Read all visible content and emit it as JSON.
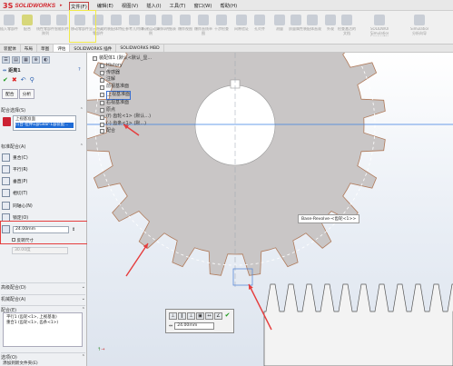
{
  "app": {
    "name": "SOLIDWORKS",
    "brand_color": "#d2232a"
  },
  "menu": [
    "文件(F)",
    "编辑(E)",
    "视图(V)",
    "插入(I)",
    "工具(T)",
    "窗口(W)",
    "帮助(H)"
  ],
  "ribbon": {
    "buttons": [
      {
        "label": "插入零部件",
        "icon": "insert-component-icon"
      },
      {
        "label": "配合",
        "icon": "mate-icon"
      },
      {
        "label": "线性零部件阵列",
        "icon": "linear-pattern-icon"
      },
      {
        "label": "智能扣件",
        "icon": "smart-fastener-icon"
      },
      {
        "label": "移动零部件",
        "icon": "move-component-icon"
      },
      {
        "label": "显示隐藏的零部件",
        "icon": "show-hidden-icon"
      },
      {
        "label": "装配体特征",
        "icon": "assembly-feature-icon"
      },
      {
        "label": "参考几何体",
        "icon": "reference-geometry-icon"
      },
      {
        "label": "新建运动算例",
        "icon": "motion-study-icon"
      },
      {
        "label": "材料明细表",
        "icon": "bom-icon"
      },
      {
        "label": "爆炸视图",
        "icon": "explode-view-icon"
      },
      {
        "label": "爆炸直线草图",
        "icon": "explode-line-icon"
      },
      {
        "label": "干涉检查",
        "icon": "interference-icon"
      },
      {
        "label": "间隙验证",
        "icon": "clearance-icon"
      },
      {
        "label": "孔对齐",
        "icon": "hole-align-icon"
      },
      {
        "label": "测量",
        "icon": "measure-icon"
      },
      {
        "label": "质量属性",
        "icon": "mass-properties-icon"
      },
      {
        "label": "装配体直观",
        "icon": "assembly-visualization-icon"
      },
      {
        "label": "外观",
        "icon": "appearance-icon"
      },
      {
        "label": "检查激活的文档",
        "icon": "check-document-icon"
      },
      {
        "label": "SOLIDWORKS Simulation Connector",
        "icon": "simulation-icon"
      },
      {
        "label": "SimulationXpress 分析向导",
        "icon": "simxpress-icon"
      },
      {
        "label": "FloXpress 分析向导",
        "icon": "floxpress-icon"
      },
      {
        "label": "DriveWorksXpress 向导",
        "icon": "driveworks-icon"
      },
      {
        "label": "Costing",
        "icon": "costing-icon"
      },
      {
        "label": "Sustainability",
        "icon": "sustainability-icon"
      }
    ]
  },
  "command_tabs": [
    "装配体",
    "布局",
    "草图",
    "评估",
    "SOLIDWORKS 插件",
    "SOLIDWORKS MBD"
  ],
  "panel": {
    "title": "距离1",
    "help": "?",
    "tabs": [
      "配合",
      "分析"
    ],
    "selections_header": "配合选择(S)",
    "selections": [
      "上视基准面",
      "凸台-拉伸1@Gear-1@装配..."
    ],
    "standard_header": "标准配合(A)",
    "standard_mates": [
      "重合(C)",
      "平行(R)",
      "垂直(P)",
      "相切(T)",
      "同轴心(N)",
      "锁定(O)"
    ],
    "distance_value": "24.00mm",
    "flip_label": "反转尺寸",
    "angle_value": "30.00度",
    "advanced_header": "高级配合(D)",
    "mechanical_header": "机械配合(A)",
    "mates_header": "配合(E)",
    "mates_list": [
      "平行1 (齿轮<1>, 上视基准)",
      "重合1 (齿轮<1>, 齿条<1>)"
    ],
    "options_header": "选项(O)",
    "options_first": "添加到新文件夹(E)"
  },
  "tree": {
    "root": "装配体1 (默认<默认_显...",
    "items": [
      "History",
      "传感器",
      "注解",
      "前视基准面",
      "上视基准面",
      "右视基准面",
      "原点",
      "(f) 齿轮<1> (默认...)",
      "(-) 齿条<1> (默...)",
      "配合"
    ]
  },
  "tooltip": "Base-Revolve-<齿轮<1>>",
  "popup": {
    "value": "24.00mm"
  },
  "highlight_colors": {
    "annotation_red": "#e53d3d",
    "selection_blue": "#1e6bd6",
    "ribbon_highlight": "#f1ea4a"
  }
}
